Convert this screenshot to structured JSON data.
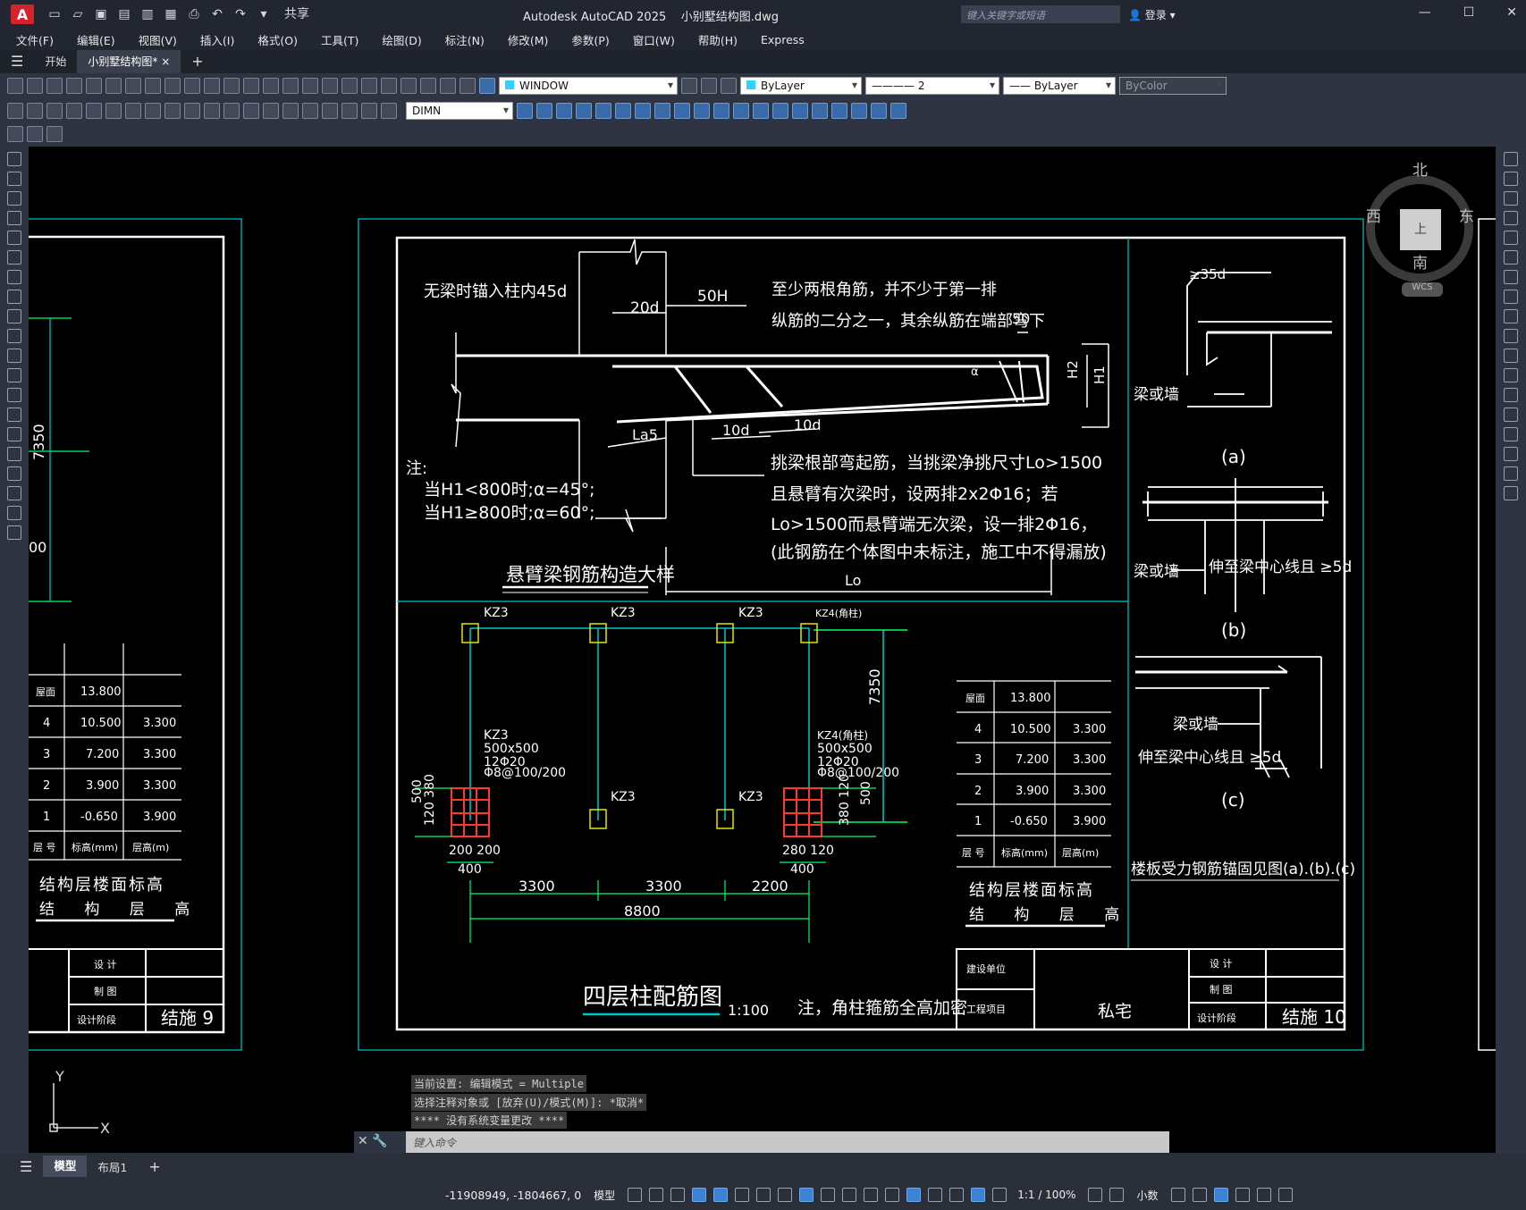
{
  "app": {
    "title": "Autodesk AutoCAD 2025",
    "file": "小别墅结构图.dwg",
    "logo": "A",
    "share_label": "共享",
    "search_placeholder": "键入关键字或短语",
    "login_label": "登录"
  },
  "menu": [
    "文件(F)",
    "编辑(E)",
    "视图(V)",
    "插入(I)",
    "格式(O)",
    "工具(T)",
    "绘图(D)",
    "标注(N)",
    "修改(M)",
    "参数(P)",
    "窗口(W)",
    "帮助(H)",
    "Express"
  ],
  "tabs": {
    "start": "开始",
    "doc": "小别墅结构图*"
  },
  "toolbar": {
    "layer_value": "WINDOW",
    "color_value": "ByLayer",
    "linetype_value": "2",
    "lineweight_value": "ByLayer",
    "plotstyle_value": "ByColor",
    "dimstyle_value": "DIMN"
  },
  "viewcube": {
    "n": "北",
    "s": "南",
    "e": "东",
    "w": "西",
    "top": "上",
    "wcs": "WCS"
  },
  "drawing": {
    "left_table": {
      "rows": [
        [
          "屋面",
          "13.800",
          ""
        ],
        [
          "4",
          "10.500",
          "3.300"
        ],
        [
          "3",
          "7.200",
          "3.300"
        ],
        [
          "2",
          "3.900",
          "3.300"
        ],
        [
          "1",
          "-0.650",
          "3.900"
        ],
        [
          "层 号",
          "标高(mm)",
          "层高(m)"
        ]
      ],
      "title1": "结构层楼面标高",
      "title2": "结 构 层 高"
    },
    "left_title_block": {
      "design": "设 计",
      "draw": "制 图",
      "stage": "设计阶段",
      "sheet": "结施 9"
    },
    "left_dim": "7350",
    "left_dim2": "00",
    "beam_detail": {
      "t1": "无梁时锚入柱内45d",
      "t2": "20d",
      "t3": "50H",
      "t4": "至少两根角筋，并不少于第一排",
      "t5": "纵筋的二分之一，其余纵筋在端部弯下",
      "t6": "50",
      "t7": "La5",
      "t8": "10d",
      "t9": "10d",
      "h2": "H2",
      "h1": "H1",
      "alpha": "α",
      "note1": "注:",
      "note2": "当H1<800时;α=45°;",
      "note3": "当H1≥800时;α=60°;",
      "n4": "挑梁根部弯起筋，当挑梁净挑尺寸Lo>1500",
      "n5": "且悬臂有次梁时，设两排2x2Φ16；若",
      "n6": "Lo>1500而悬臂端无次梁，设一排2Φ16，",
      "n7": "(此钢筋在个体图中未标注，施工中不得漏放)",
      "title": "悬臂梁钢筋构造大样",
      "lo": "Lo"
    },
    "anchor": {
      "a_dim": "≥35d",
      "a_label": "梁或墙",
      "a_cap": "(a)",
      "b_label": "梁或墙",
      "b_text": "伸至梁中心线且 ≥5d",
      "b_cap": "(b)",
      "c_label": "梁或墙",
      "c_text": "伸至梁中心线且 ≥5d",
      "c_cap": "(c)",
      "note": "楼板受力钢筋锚固见图(a).(b).(c)"
    },
    "column_plan": {
      "kz_top": [
        "KZ3",
        "KZ3",
        "KZ3",
        "KZ4(角柱)"
      ],
      "kz_mid": [
        "KZ3",
        "KZ3"
      ],
      "kz3_spec": [
        "KZ3",
        "500x500",
        "12Φ20",
        "Φ8@100/200"
      ],
      "kz4_spec": [
        "KZ4(角柱)",
        "500x500",
        "12Φ20",
        "Φ8@100/200"
      ],
      "d_500": "500",
      "d_120_380": "120 380",
      "d_380_120": "380 120",
      "d_500b": "500",
      "d_200_200": "200 200",
      "d_280_120": "280 120",
      "d_400": "400",
      "d_400b": "400",
      "spans": [
        "3300",
        "3300",
        "2200"
      ],
      "total": "8800",
      "d_7350": "7350",
      "title": "四层柱配筋图",
      "scale": "1:100",
      "note": "注，角柱箍筋全高加密"
    },
    "right_table": {
      "rows": [
        [
          "屋面",
          "13.800",
          ""
        ],
        [
          "4",
          "10.500",
          "3.300"
        ],
        [
          "3",
          "7.200",
          "3.300"
        ],
        [
          "2",
          "3.900",
          "3.300"
        ],
        [
          "1",
          "-0.650",
          "3.900"
        ],
        [
          "层 号",
          "标高(mm)",
          "层高(m)"
        ]
      ],
      "title1": "结构层楼面标高",
      "title2": "结 构 层 高"
    },
    "right_title_block": {
      "owner": "建设单位",
      "project": "工程项目",
      "project_name": "私宅",
      "design": "设 计",
      "draw": "制 图",
      "stage": "设计阶段",
      "sheet": "结施 10"
    },
    "ucs": {
      "x": "X",
      "y": "Y"
    }
  },
  "command": {
    "hist1": "当前设置: 编辑模式 = Multiple",
    "hist2": "选择注释对象或 [放弃(U)/模式(M)]: *取消*",
    "hist3": "**** 没有系统变量更改 ****",
    "placeholder": "键入命令"
  },
  "layouts": {
    "model": "模型",
    "layout1": "布局1"
  },
  "status": {
    "coords": "-11908949, -1804667, 0",
    "model": "模型",
    "scale": "1:1 / 100%",
    "units": "小数"
  }
}
